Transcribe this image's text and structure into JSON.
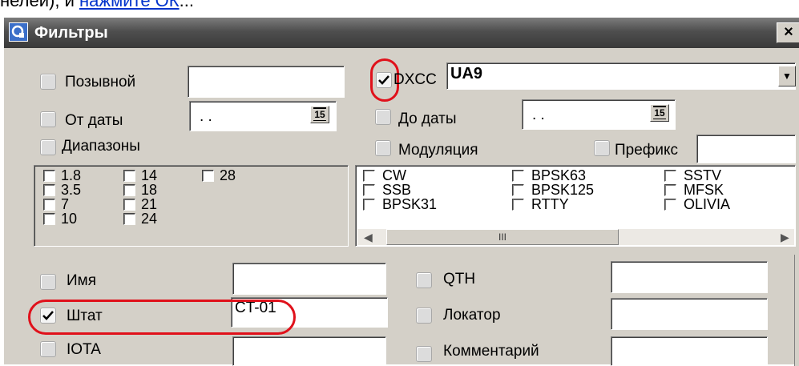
{
  "page_text": {
    "prefix": "нелей), и ",
    "link": "нажмите ОК",
    "suffix": "..."
  },
  "window": {
    "title": "Фильтры",
    "close_glyph": "×"
  },
  "fields": {
    "callsign_label": "Позывной",
    "callsign_value": "",
    "from_date_label": "От даты",
    "from_date_value": ". .",
    "to_date_label": "До даты",
    "to_date_value": ". .",
    "calendar_glyph": "15",
    "dxcc_label": "DXCC",
    "dxcc_value": "UA9",
    "bands_label": "Диапазоны",
    "mode_label": "Модуляция",
    "prefix_label": "Префикс",
    "prefix_value": "",
    "name_label": "Имя",
    "name_value": "",
    "qth_label": "QTH",
    "qth_value": "",
    "state_label": "Штат",
    "state_value": "CT-01",
    "locator_label": "Локатор",
    "locator_value": "",
    "iota_label": "IOTA",
    "iota_value": "",
    "comment_label": "Комментарий",
    "comment_value": ""
  },
  "bands": [
    "1.8",
    "3.5",
    "7",
    "10",
    "14",
    "18",
    "21",
    "24",
    "28"
  ],
  "modes": [
    "CW",
    "SSB",
    "BPSK31",
    "BPSK63",
    "BPSK125",
    "RTTY",
    "SSTV",
    "MFSK",
    "OLIVIA"
  ],
  "checked": {
    "dxcc": true,
    "state": true
  },
  "scrollbar": {
    "left_arrow": "◀",
    "right_arrow": "▶",
    "thumb_grip": "III"
  },
  "colors": {
    "highlight_ring": "#e0111b",
    "titlebar": "#4e4e4e",
    "link": "#0033cc"
  }
}
